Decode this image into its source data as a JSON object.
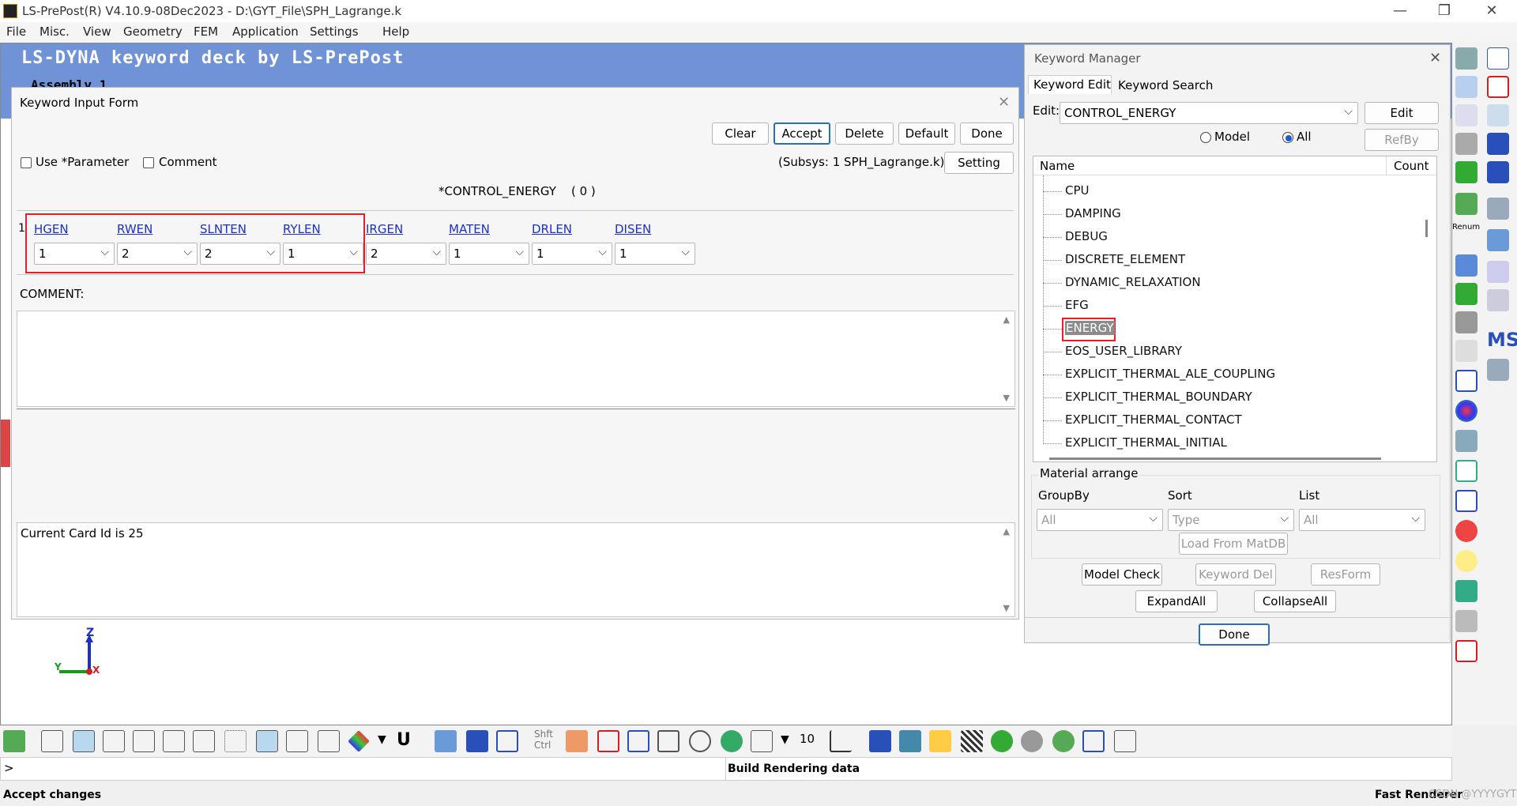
{
  "window": {
    "title": "LS-PrePost(R) V4.10.9-08Dec2023 - D:\\GYT_File\\SPH_Lagrange.k",
    "minimize": "—",
    "restore": "❐",
    "close": "✕"
  },
  "menu": [
    "File",
    "Misc.",
    "View",
    "Geometry",
    "FEM",
    "Application",
    "Settings",
    "Help"
  ],
  "viewport": {
    "deck_title": "LS-DYNA keyword deck by LS-PrePost",
    "assembly": "Assembly 1",
    "axis": {
      "z": "Z",
      "y": "Y",
      "x": "X"
    }
  },
  "kif": {
    "title": "Keyword Input Form",
    "buttons": {
      "clear": "Clear",
      "accept": "Accept",
      "delete": "Delete",
      "default": "Default",
      "done": "Done",
      "setting": "Setting"
    },
    "use_parameter": "Use *Parameter",
    "comment_check": "Comment",
    "subsys": "(Subsys: 1 SPH_Lagrange.k)",
    "keyword_heading": "*CONTROL_ENERGY    ( 0 )",
    "card_row_number": "1",
    "fields": [
      {
        "name": "HGEN",
        "value": "1"
      },
      {
        "name": "RWEN",
        "value": "2"
      },
      {
        "name": "SLNTEN",
        "value": "2"
      },
      {
        "name": "RYLEN",
        "value": "1"
      },
      {
        "name": "IRGEN",
        "value": "2"
      },
      {
        "name": "MATEN",
        "value": "1"
      },
      {
        "name": "DRLEN",
        "value": "1"
      },
      {
        "name": "DISEN",
        "value": "1"
      }
    ],
    "comment_label": "COMMENT:",
    "message": "Current Card Id is 25"
  },
  "keyword_manager": {
    "title": "Keyword Manager",
    "tabs": [
      "Keyword Edit",
      "Keyword Search"
    ],
    "edit_label": "Edit:",
    "edit_value": "CONTROL_ENERGY",
    "edit_button": "Edit",
    "radio_model": "Model",
    "radio_all": "All",
    "refby": "RefBy",
    "col_name": "Name",
    "col_count": "Count",
    "tree_items": [
      "CPU",
      "DAMPING",
      "DEBUG",
      "DISCRETE_ELEMENT",
      "DYNAMIC_RELAXATION",
      "EFG",
      "ENERGY",
      "EOS_USER_LIBRARY",
      "EXPLICIT_THERMAL_ALE_COUPLING",
      "EXPLICIT_THERMAL_BOUNDARY",
      "EXPLICIT_THERMAL_CONTACT",
      "EXPLICIT_THERMAL_INITIAL"
    ],
    "selected_item": "ENERGY",
    "material_arrange": "Material arrange",
    "groupby_label": "GroupBy",
    "sort_label": "Sort",
    "list_label": "List",
    "groupby_value": "All",
    "sort_value": "Type",
    "list_value": "All",
    "load_matdb": "Load From MatDB",
    "model_check": "Model Check",
    "keyword_del": "Keyword Del",
    "resform": "ResForm",
    "expand_all": "ExpandAll",
    "collapse_all": "CollapseAll",
    "done": "Done"
  },
  "right_icons": [
    "MS",
    "Renum"
  ],
  "bottom": {
    "shft_ctrl": "Shft Ctrl",
    "u_label": "U",
    "ten_label": "10",
    "cmd_prompt": ">",
    "status_message": "Build Rendering data",
    "status_left": "Accept changes",
    "status_right": "Fast Renderer",
    "watermark": "CSDN @YYYYGYT"
  },
  "colors": {
    "accent": "#2a6ebb",
    "highlight": "#e0202a",
    "viewport_band": "#6f93d6"
  }
}
